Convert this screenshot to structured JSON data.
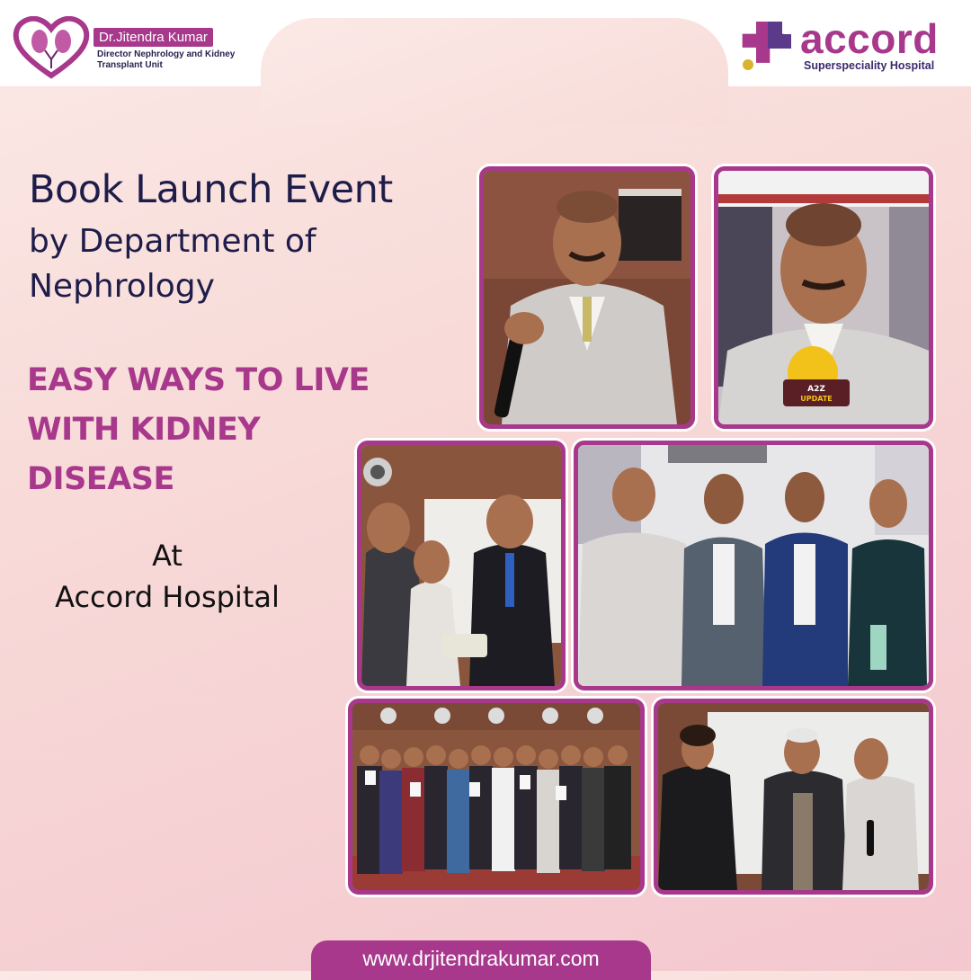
{
  "header": {
    "doctor_name": "Dr.Jitendra Kumar",
    "doctor_role": "Director Nephrology and Kidney Transplant Unit",
    "hospital_name": "accord",
    "hospital_subtitle": "Superspeciality Hospital"
  },
  "content": {
    "title": "Book Launch Event",
    "subtitle_line1": "by  Department of",
    "subtitle_line2": "Nephrology",
    "book_title_line1": "EASY WAYS TO LIVE",
    "book_title_line2": "WITH KIDNEY",
    "book_title_line3": "DISEASE",
    "at_label": "At",
    "venue": "Accord Hospital"
  },
  "photos": {
    "mic_badge_line1": "A2Z",
    "mic_badge_line2": "UPDATE"
  },
  "footer": {
    "website": "www.drjitendrakumar.com"
  },
  "colors": {
    "brand": "#a7388c",
    "navy": "#1e1d4a"
  }
}
